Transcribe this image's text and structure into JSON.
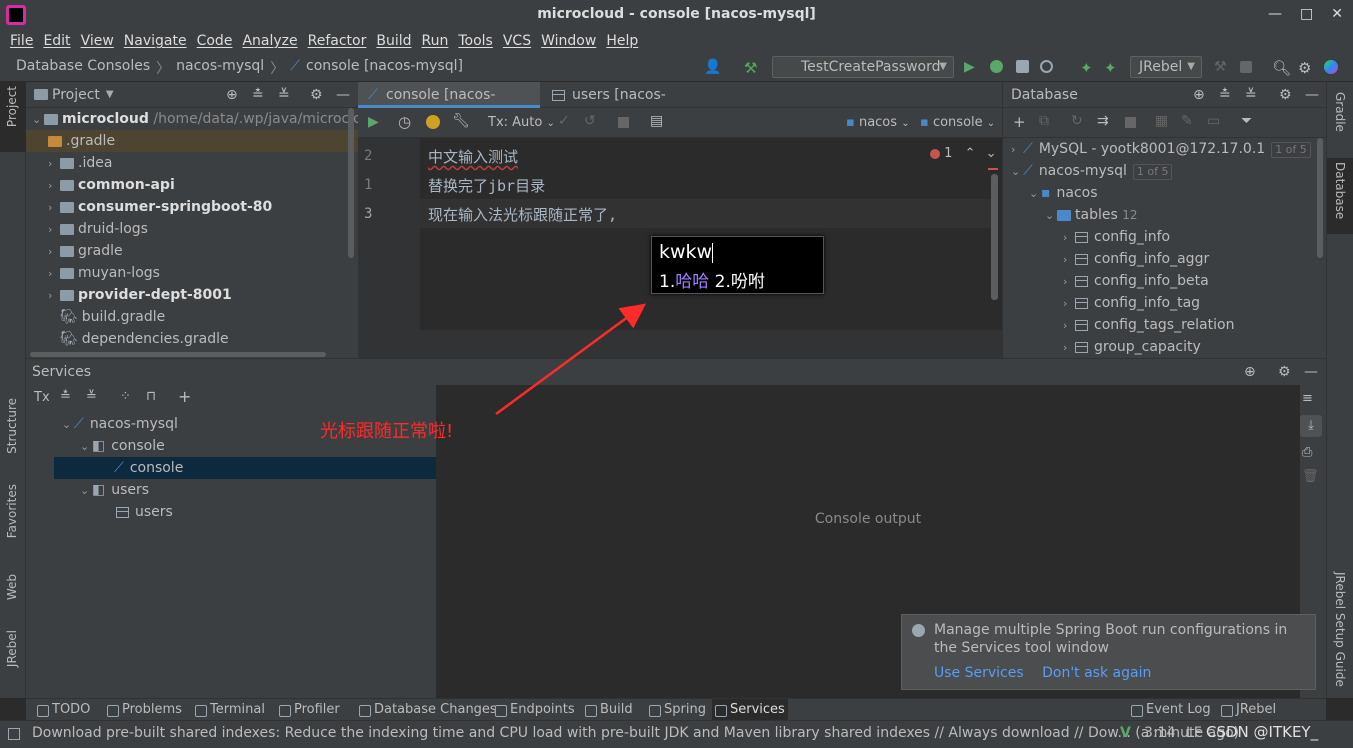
{
  "window": {
    "title": "microcloud - console [nacos-mysql]",
    "controls": [
      "—",
      "□",
      "✕"
    ]
  },
  "menu": [
    "File",
    "Edit",
    "View",
    "Navigate",
    "Code",
    "Analyze",
    "Refactor",
    "Build",
    "Run",
    "Tools",
    "VCS",
    "Window",
    "Help"
  ],
  "breadcrumb": [
    "Database Consoles",
    "nacos-mysql",
    "console [nacos-mysql]"
  ],
  "toolbar": {
    "run_config": "TestCreatePassword",
    "jrebel": "JRebel"
  },
  "project": {
    "title": "Project",
    "root": {
      "name": "microcloud",
      "path": "/home/data/.wp/java/microcloud"
    },
    "items": [
      {
        "name": ".gradle",
        "type": "folder-orange",
        "bold": false
      },
      {
        "name": ".idea",
        "type": "folder",
        "bold": false
      },
      {
        "name": "common-api",
        "type": "module",
        "bold": true
      },
      {
        "name": "consumer-springboot-80",
        "type": "module",
        "bold": true
      },
      {
        "name": "druid-logs",
        "type": "folder",
        "bold": false
      },
      {
        "name": "gradle",
        "type": "folder",
        "bold": false
      },
      {
        "name": "muyan-logs",
        "type": "folder",
        "bold": false
      },
      {
        "name": "provider-dept-8001",
        "type": "module",
        "bold": true
      },
      {
        "name": "build.gradle",
        "type": "file",
        "bold": false
      },
      {
        "name": "dependencies.gradle",
        "type": "file",
        "bold": false
      }
    ]
  },
  "editor": {
    "tabs": [
      {
        "label": "console [nacos-mysql]",
        "active": true
      },
      {
        "label": "users [nacos-mysql]",
        "active": false
      }
    ],
    "tx": "Tx: Auto",
    "schema": "nacos",
    "session": "console",
    "error_count": "1",
    "lines": [
      {
        "num": "2",
        "text": "中文输入测试"
      },
      {
        "num": "1",
        "text": "替换完了jbr目录"
      },
      {
        "num": "3",
        "text": "现在输入法光标跟随正常了,"
      }
    ]
  },
  "ime": {
    "input": "kwkw",
    "cand_1_num": "1.",
    "cand_1": "哈哈",
    "cand_2": "2.吩咐"
  },
  "database": {
    "title": "Database",
    "sources": [
      {
        "name": "MySQL - yootk8001@172.17.0.1",
        "badge": "1 of 5"
      },
      {
        "name": "nacos-mysql",
        "badge": "1 of 5"
      }
    ],
    "schema": "nacos",
    "tables_label": "tables",
    "tables_count": "12",
    "tables": [
      "config_info",
      "config_info_aggr",
      "config_info_beta",
      "config_info_tag",
      "config_tags_relation",
      "group_capacity"
    ]
  },
  "services": {
    "title": "Services",
    "tree": [
      {
        "label": "nacos-mysql",
        "indent": 0
      },
      {
        "label": "console",
        "indent": 1
      },
      {
        "label": "console",
        "indent": 2,
        "selected": true
      },
      {
        "label": "users",
        "indent": 1
      },
      {
        "label": "users",
        "indent": 2
      }
    ],
    "console_output": "Console output"
  },
  "annotation": "光标跟随正常啦!",
  "notification": {
    "message": "Manage multiple Spring Boot run configurations in the Services tool window",
    "link_use": "Use Services",
    "link_dont": "Don't ask again"
  },
  "left_strip": [
    "Project",
    "Structure",
    "Favorites",
    "Web",
    "JRebel"
  ],
  "right_strip": [
    "Gradle",
    "Database",
    "JRebel Setup Guide"
  ],
  "bottom_tabs": [
    "TODO",
    "Problems",
    "Terminal",
    "Profiler",
    "Database Changes",
    "Endpoints",
    "Build",
    "Spring",
    "Services"
  ],
  "bottom_right": [
    "Event Log",
    "JRebel Console"
  ],
  "status": {
    "message": "Download pre-built shared indexes: Reduce the indexing time and CPU load with pre-built JDK and Maven library shared indexes // Always download // Dow... (a minute ago)",
    "position": "3:14",
    "line_sep": "LF",
    "watermark": "CSDN @ITKEY_"
  },
  "colors": {
    "accent": "#4a88c7",
    "annotation": "#ff2a2a",
    "link": "#589df6",
    "selection": "#0d293e"
  }
}
